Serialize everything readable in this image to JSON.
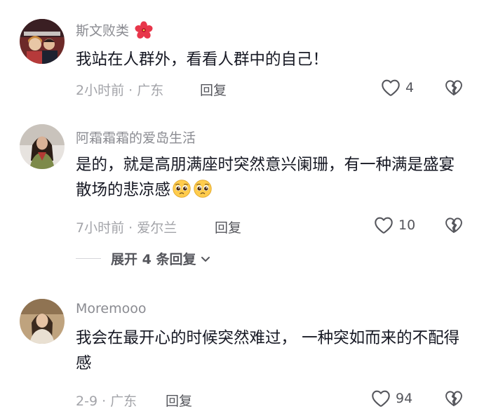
{
  "comments": [
    {
      "username": "斯文败类",
      "username_emoji": "hibiscus-icon",
      "text": "我站在人群外，看看人群中的自己！",
      "meta": "2小时前 · 广东",
      "reply_label": "回复",
      "likes": "4"
    },
    {
      "username": "阿霜霜霜的爱岛生活",
      "text": "是的，就是高朋满座时突然意兴阑珊，有一种满是盛宴散场的悲凉感",
      "text_emoji": "pleading-face-icon",
      "meta": "7小时前 · 爱尔兰",
      "reply_label": "回复",
      "likes": "10",
      "expand_label": "展开 4 条回复"
    },
    {
      "username": "Moremooo",
      "text": "我会在最开心的时候突然难过， 一种突如而来的不配得感",
      "meta": "2-9 · 广东",
      "reply_label": "回复",
      "likes": "94"
    }
  ],
  "colors": {
    "username": "#8a8b91",
    "text": "#161823",
    "meta": "#a3a4a9",
    "action": "#55565c"
  }
}
